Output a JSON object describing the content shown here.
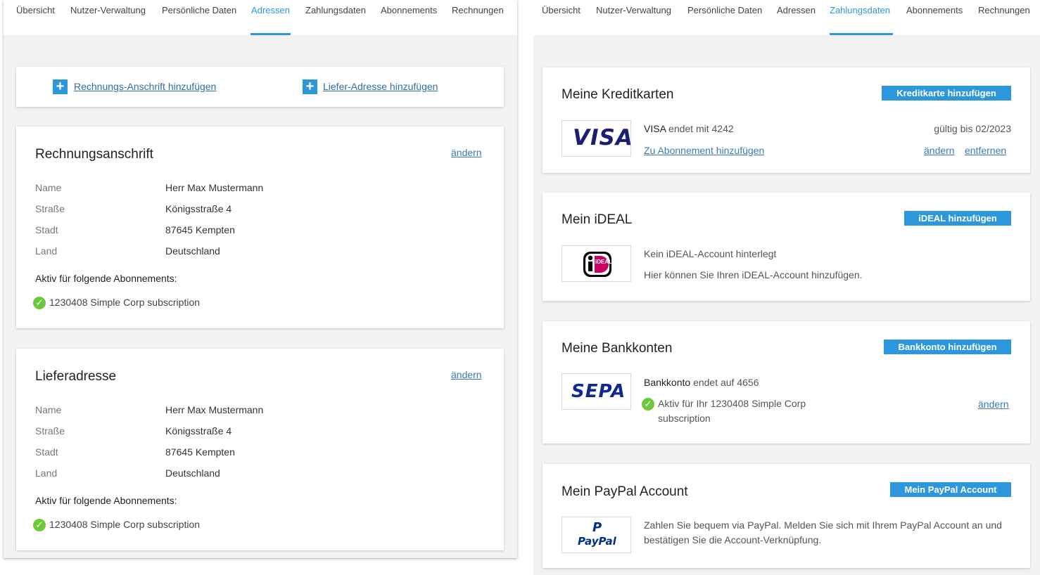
{
  "left": {
    "tabs": [
      "Übersicht",
      "Nutzer-Verwaltung",
      "Persönliche Daten",
      "Adressen",
      "Zahlungsdaten",
      "Abonnements",
      "Rechnungen"
    ],
    "active_tab": "Adressen",
    "add_billing_link": "Rechnungs-Anschrift hinzufügen",
    "add_shipping_link": "Liefer-Adresse hinzufügen",
    "billing": {
      "title": "Rechnungsanschrift",
      "edit_link": "ändern",
      "labels": [
        "Name",
        "Straße",
        "Stadt",
        "Land"
      ],
      "values": [
        "Herr Max Mustermann",
        "Königsstraße 4",
        "87645 Kempten",
        "Deutschland"
      ],
      "active_heading": "Aktiv für folgende Abonnements:",
      "subscription": "1230408 Simple Corp subscription"
    },
    "shipping": {
      "title": "Lieferadresse",
      "edit_link": "ändern",
      "labels": [
        "Name",
        "Straße",
        "Stadt",
        "Land"
      ],
      "values": [
        "Herr Max Mustermann",
        "Königsstraße 4",
        "87645 Kempten",
        "Deutschland"
      ],
      "active_heading": "Aktiv für folgende Abonnements:",
      "subscription": "1230408 Simple Corp subscription"
    }
  },
  "right": {
    "tabs": [
      "Übersicht",
      "Nutzer-Verwaltung",
      "Persönliche Daten",
      "Adressen",
      "Zahlungsdaten",
      "Abonnements",
      "Rechnungen"
    ],
    "active_tab": "Zahlungsdaten",
    "credit_cards": {
      "title": "Meine Kreditkarten",
      "button": "Kreditkarte hinzufügen",
      "logo_text": "VISA",
      "brand": "VISA",
      "ending_text": "endet mit 4242",
      "valid_text": "gültig bis 02/2023",
      "add_to_subscription_link": "Zu Abonnement hinzufügen",
      "edit_link": "ändern",
      "remove_link": "entfernen"
    },
    "ideal": {
      "title": "Mein iDEAL",
      "button": "iDEAL hinzufügen",
      "logo_text": "iDEAL",
      "line1": "Kein iDEAL-Account hinterlegt",
      "line2": "Hier können Sie Ihren iDEAL-Account hinzufügen."
    },
    "bank": {
      "title": "Meine Bankkonten",
      "button": "Bankkonto hinzufügen",
      "logo_text": "SEPA",
      "label": "Bankkonto",
      "ending_text": "endet auf 4656",
      "active_line1": "Aktiv für Ihr 1230408 Simple Corp",
      "active_line2": "subscription",
      "edit_link": "ändern"
    },
    "paypal": {
      "title": "Mein PayPal Account",
      "button": "Mein PayPal Account",
      "logo_text": "PayPal",
      "line1": "Zahlen Sie bequem via PayPal. Melden Sie sich mit Ihrem PayPal Account an und",
      "line2": "bestätigen Sie die Account-Verknüpfung."
    }
  },
  "colors": {
    "accent": "#2d97de",
    "link": "#3a7bb1",
    "check": "#6cc93a",
    "visa_blue": "#1a1f71",
    "visa_gold": "#f7b600",
    "ideal_pink": "#cc0066",
    "sepa_blue": "#10298e",
    "sepa_yellow": "#ffbe00",
    "paypal_dark": "#003087",
    "paypal_light": "#009cde"
  }
}
